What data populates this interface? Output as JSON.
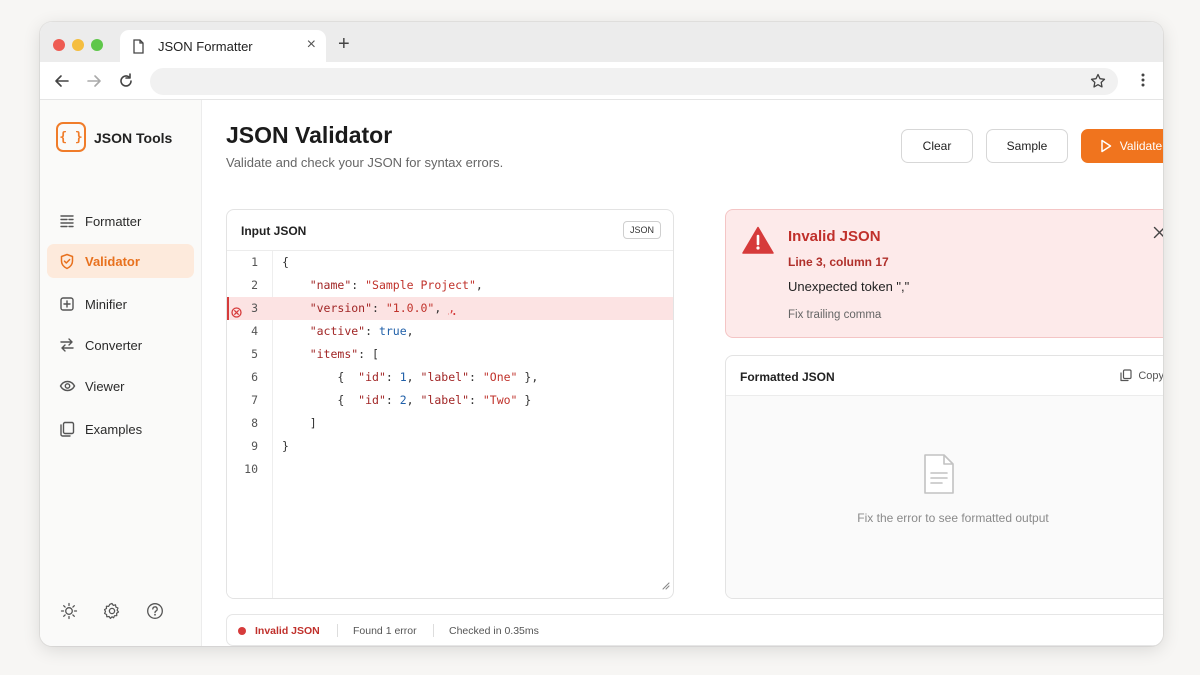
{
  "browser": {
    "tab_title": "JSON Formatter",
    "new_tab": "+",
    "tab_close": "×",
    "address": ""
  },
  "app": {
    "name": "JSON Tools",
    "logo_glyph": "{ }",
    "accent": "#f0741e"
  },
  "sidebar": {
    "items": [
      {
        "label": "Formatter",
        "icon": "formatter-icon"
      },
      {
        "label": "Validator",
        "icon": "shield-check-icon",
        "active": true
      },
      {
        "label": "Minifier",
        "icon": "minifier-icon"
      },
      {
        "label": "Converter",
        "icon": "converter-icon"
      },
      {
        "label": "Viewer",
        "icon": "eye-icon"
      },
      {
        "label": "Examples",
        "icon": "examples-icon"
      }
    ],
    "footer_icons": [
      "sun-icon",
      "gear-icon",
      "help-icon"
    ]
  },
  "header": {
    "title": "JSON Validator",
    "subtitle": "Validate and check your JSON for syntax errors.",
    "clear_label": "Clear",
    "sample_label": "Sample",
    "validate_label": "Validate"
  },
  "input_panel": {
    "title": "Input JSON",
    "badge": "JSON",
    "line_numbers": [
      "1",
      "2",
      "3",
      "4",
      "5",
      "6",
      "7",
      "8",
      "9",
      "10"
    ],
    "error_line": 3
  },
  "error": {
    "title": "Invalid JSON",
    "location": "Line 3, column 17",
    "message": "Unexpected token \",\"",
    "hint": "Fix trailing comma"
  },
  "formatted_panel": {
    "title": "Formatted JSON",
    "copy_label": "Copy",
    "empty_text": "Fix the error to see formatted output"
  },
  "status": {
    "state": "Invalid JSON",
    "errors": "Found 1 error",
    "timing": "Checked in 0.35ms"
  }
}
